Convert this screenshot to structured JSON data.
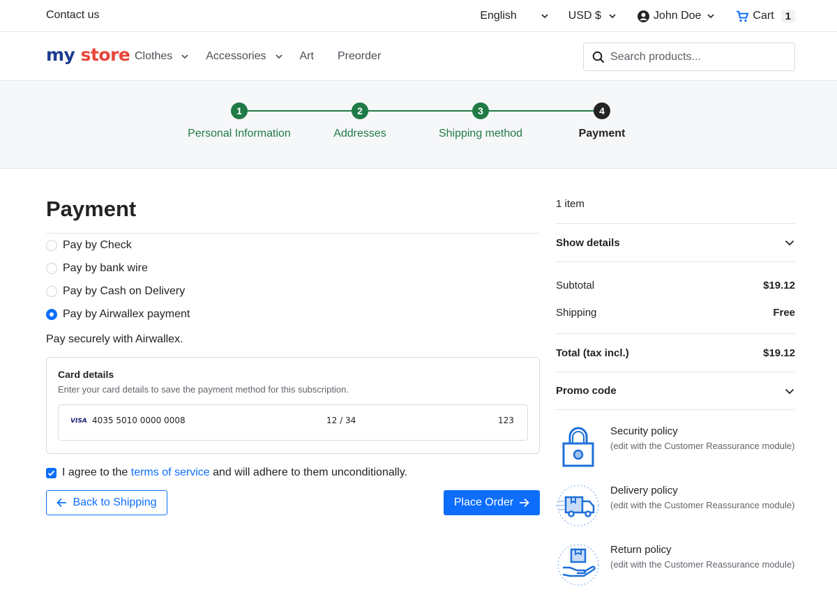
{
  "topbar": {
    "contact": "Contact us",
    "language": "English",
    "currency": "USD $",
    "user": "John Doe",
    "cart_label": "Cart",
    "cart_count": "1"
  },
  "header": {
    "logo": {
      "part1": "my",
      "part2": "store"
    },
    "nav": [
      {
        "label": "Clothes",
        "dropdown": true
      },
      {
        "label": "Accessories",
        "dropdown": true
      },
      {
        "label": "Art",
        "dropdown": false
      },
      {
        "label": "Preorder",
        "dropdown": false
      }
    ],
    "search_placeholder": "Search products..."
  },
  "steps": [
    {
      "number": "1",
      "label": "Personal Information",
      "state": "done"
    },
    {
      "number": "2",
      "label": "Addresses",
      "state": "done"
    },
    {
      "number": "3",
      "label": "Shipping method",
      "state": "done"
    },
    {
      "number": "4",
      "label": "Payment",
      "state": "active"
    }
  ],
  "payment": {
    "title": "Payment",
    "options": [
      {
        "label": "Pay by Check",
        "selected": false
      },
      {
        "label": "Pay by bank wire",
        "selected": false
      },
      {
        "label": "Pay by Cash on Delivery",
        "selected": false
      },
      {
        "label": "Pay by Airwallex payment",
        "selected": true
      }
    ],
    "description": "Pay securely with Airwallex.",
    "card": {
      "title": "Card details",
      "subtitle": "Enter your card details to save the payment method for this subscription.",
      "brand": "VISA",
      "number": "4035 5010 0000 0008",
      "expiry": "12 / 34",
      "cvc": "123"
    },
    "agree_prefix": "I agree to the",
    "agree_link": "terms of service",
    "agree_suffix": "and will adhere to them unconditionally.",
    "back_label": "Back to Shipping",
    "order_label": "Place Order"
  },
  "summary": {
    "items_count": "1 item",
    "show_details": "Show details",
    "subtotal_label": "Subtotal",
    "subtotal_value": "$19.12",
    "shipping_label": "Shipping",
    "shipping_value": "Free",
    "total_label": "Total (tax incl.)",
    "total_value": "$19.12",
    "promo_label": "Promo code"
  },
  "reassurance": [
    {
      "title": "Security policy",
      "desc": "(edit with the Customer Reassurance module)",
      "icon": "lock-icon"
    },
    {
      "title": "Delivery policy",
      "desc": "(edit with the Customer Reassurance module)",
      "icon": "delivery-truck-icon"
    },
    {
      "title": "Return policy",
      "desc": "(edit with the Customer Reassurance module)",
      "icon": "return-box-icon"
    }
  ],
  "colors": {
    "accent": "#0d6efd",
    "step_done": "#1f7a45",
    "step_active": "#232323"
  }
}
